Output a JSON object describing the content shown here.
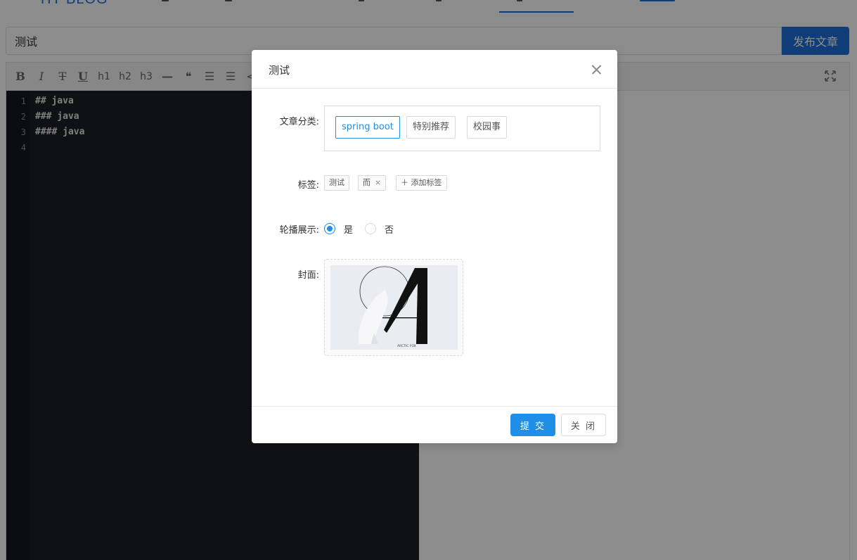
{
  "nav": {
    "brand": "HY BLOG"
  },
  "editor": {
    "title_value": "测试",
    "publish_label": "发布文章",
    "toolbar": {
      "bold": "B",
      "italic": "I",
      "strikethrough": "T",
      "underline": "U",
      "h1": "h1",
      "h2": "h2",
      "h3": "h3",
      "hr": "—",
      "quote": "❝",
      "ul": "☰",
      "ol": "☰",
      "code": "<"
    },
    "line_numbers": [
      "1",
      "2",
      "3",
      "4"
    ],
    "code_lines": [
      "## java",
      "### java",
      "#### java",
      ""
    ]
  },
  "modal": {
    "title": "测试",
    "category_label": "文章分类:",
    "categories": [
      "spring boot",
      "特别推荐",
      "校园事"
    ],
    "selected_category": "spring boot",
    "tags_label": "标签:",
    "tags": [
      "测试",
      "而"
    ],
    "tag_close_icon": "×",
    "add_tag_label": "＋ 添加标签",
    "carousel_label": "轮播展示:",
    "carousel_options": [
      "是",
      "否"
    ],
    "carousel_selected": "是",
    "cover_label": "封面:",
    "cover_caption": "ARCTIC FOX",
    "submit_label": "提 交",
    "close_label": "关 闭"
  },
  "colors": {
    "primary": "#1e8ee8",
    "nav_blue": "#1e6fd9",
    "code_bg": "#1d1f27"
  }
}
